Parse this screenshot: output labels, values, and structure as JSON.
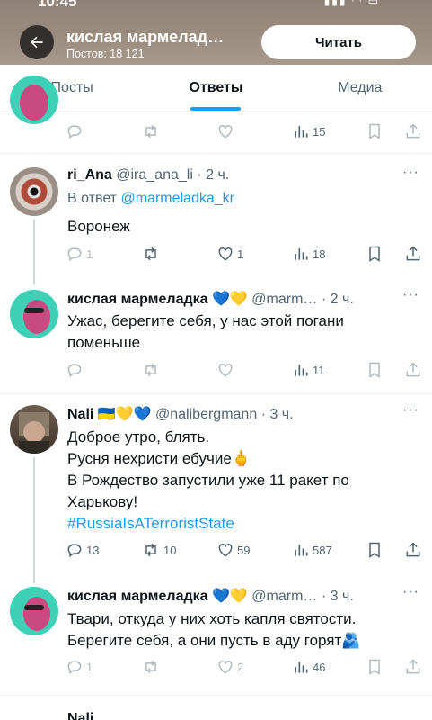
{
  "status": {
    "time": "10:45"
  },
  "header": {
    "title": "кислая мармелад…",
    "subtitle": "Постов: 18 121",
    "follow_label": "Читать"
  },
  "tabs": [
    {
      "label": "Посты"
    },
    {
      "label": "Ответы",
      "active": true
    },
    {
      "label": "Медиа"
    }
  ],
  "posts": [
    {
      "actions": {
        "replies": "",
        "reposts": "",
        "likes": "",
        "views": "15"
      }
    },
    {
      "name": "ri_Ana",
      "handle": "@ira_ana_li",
      "time": "· 2 ч.",
      "reply_prefix": "В ответ",
      "reply_to": "@marmeladka_kr",
      "text": "Воронеж",
      "actions": {
        "replies": "1",
        "reposts": "",
        "likes": "1",
        "views": "18"
      }
    },
    {
      "name": "кислая мармеладка",
      "emoji": "💙💛",
      "handle": "@marm…",
      "time": "· 2 ч.",
      "text": "Ужас, берегите себя, у нас этой погани поменьше",
      "actions": {
        "replies": "",
        "reposts": "",
        "likes": "",
        "views": "11"
      }
    },
    {
      "name": "Nali",
      "emoji": "🇺🇦💛💙",
      "handle": "@nalibergmann",
      "time": "· 3 ч.",
      "lines": [
        "Доброе утро, блять.",
        "Русня нехристи ебучие🖕",
        "В Рождество запустили уже 11 ракет по Харькову!"
      ],
      "hashtag": "#RussiaIsATerroristState",
      "actions": {
        "replies": "13",
        "reposts": "10",
        "likes": "59",
        "views": "587"
      }
    },
    {
      "name": "кислая мармеладка",
      "emoji": "💙💛",
      "handle": "@marm…",
      "time": "· 3 ч.",
      "text": "Твари, откуда у них хоть капля святости. Берегите себя, а они пусть в аду горят🫂",
      "actions": {
        "replies": "1",
        "reposts": "",
        "likes": "2",
        "views": "46"
      }
    }
  ],
  "peek": {
    "name": "Nali"
  },
  "colors": {
    "accent": "#1d9bf0",
    "muted": "#536471",
    "text": "#0f1419",
    "header_bg": "#9a8c7f"
  },
  "icons": [
    "back-arrow-icon",
    "reply-icon",
    "repost-icon",
    "like-icon",
    "views-icon",
    "bookmark-icon",
    "share-icon",
    "more-icon"
  ]
}
